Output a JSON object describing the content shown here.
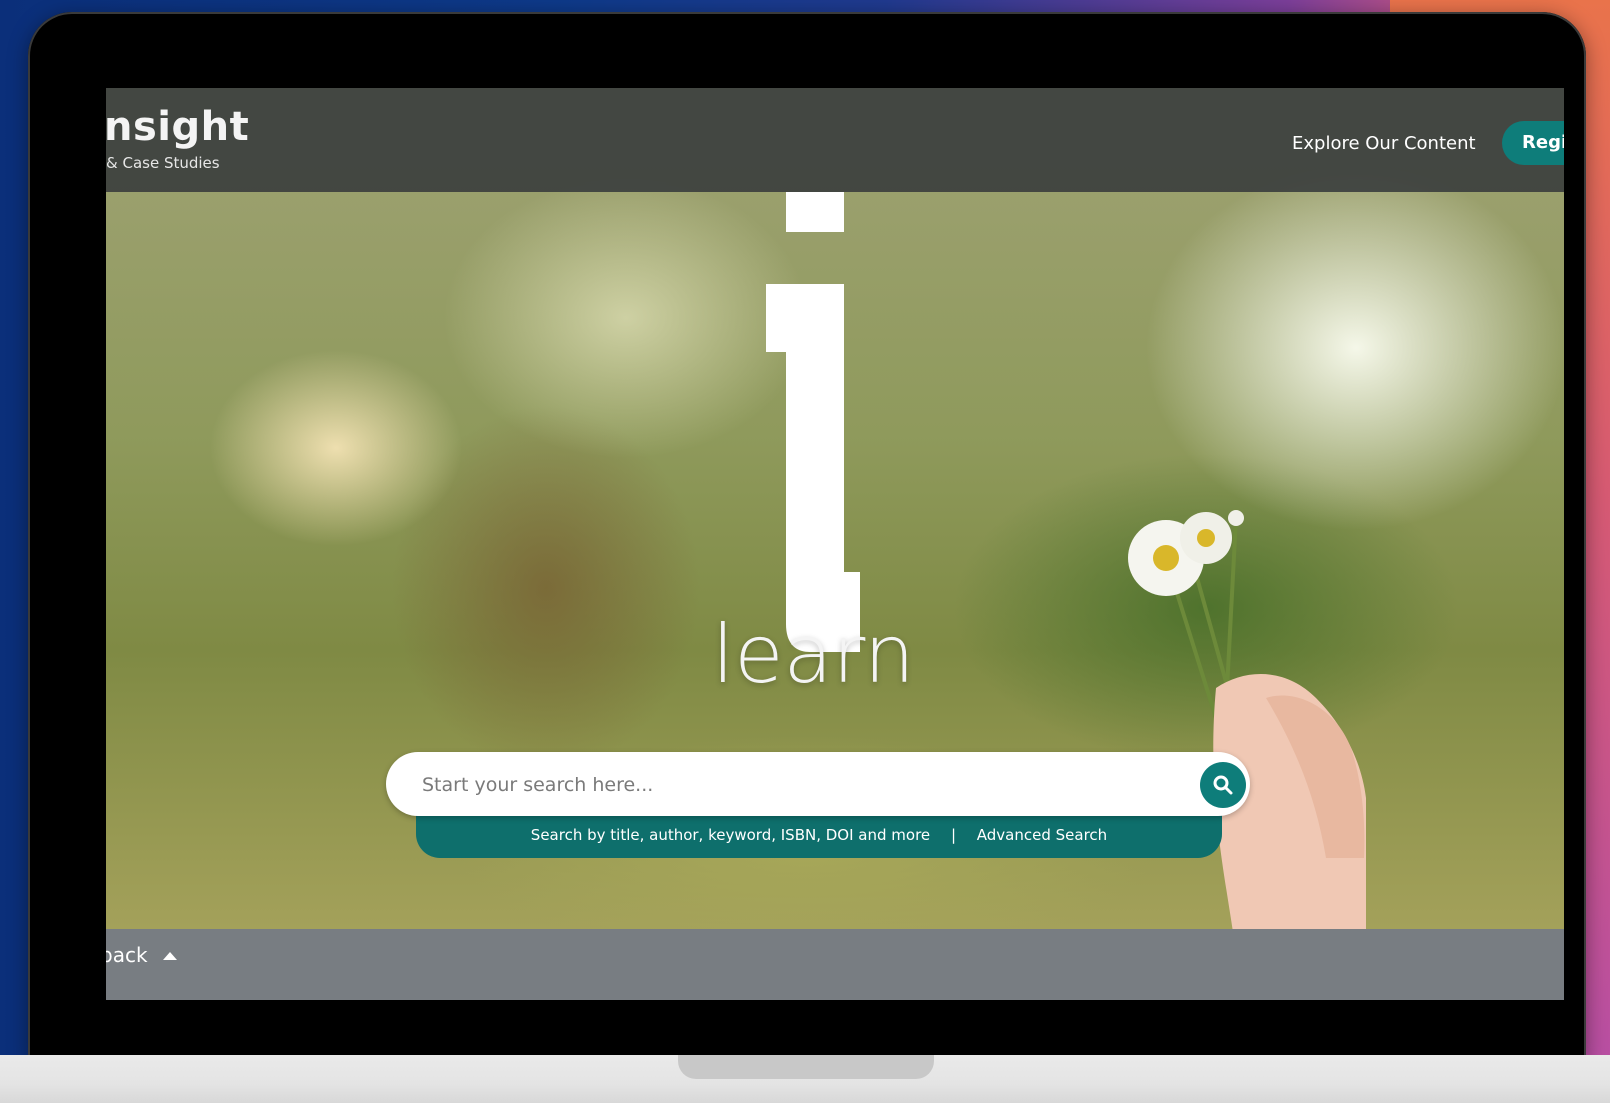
{
  "header": {
    "logo_text": "nsight",
    "logo_subtitle": "& Case Studies",
    "explore_link": "Explore Our Content",
    "register_label": "Regis"
  },
  "hero": {
    "tagline": "learn"
  },
  "search": {
    "placeholder": "Start your search here...",
    "hint": "Search by title, author, keyword, ISBN, DOI and more",
    "separator": "|",
    "advanced_link": "Advanced Search",
    "button_icon": "search-icon"
  },
  "footer": {
    "feedback_label": "back",
    "feedback_icon": "caret-up-icon"
  },
  "colors": {
    "teal": "#0e7d7a",
    "teal_dark": "#0e6f6c",
    "header_bg": "#34383a",
    "footer_bg": "#787d82"
  }
}
